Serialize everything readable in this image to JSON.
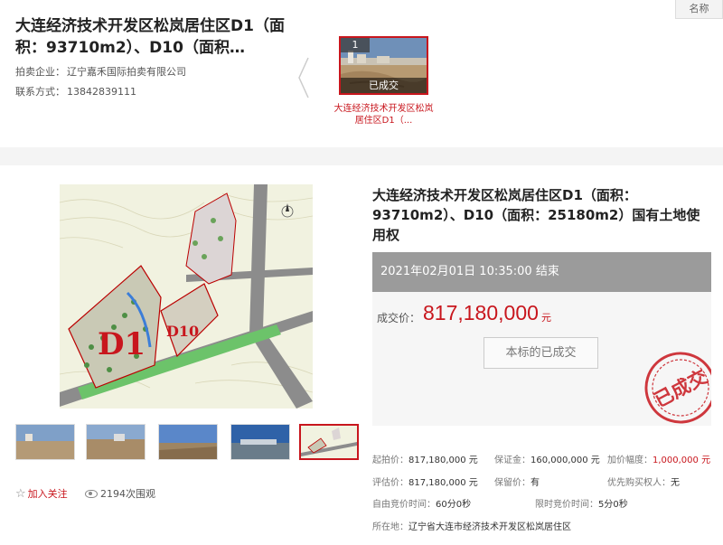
{
  "header": {
    "title": "大连经济技术开发区松岚居住区D1（面积：93710m2）、D10（面积…",
    "company_label": "拍卖企业：",
    "company_name": "辽宁嘉禾国际拍卖有限公司",
    "contact_label": "联系方式：",
    "contact_phone": "13842839111",
    "sort_label": "名称"
  },
  "lot_card": {
    "number": "1",
    "status": "已成交",
    "caption": "大连经济技术开发区松岚居住区D1（..."
  },
  "gallery": {
    "map_labels": [
      "D1",
      "D10"
    ],
    "thumb_count": 5,
    "active_thumb": 4
  },
  "social": {
    "follow_label": "加入关注",
    "views_label": "2194次围观"
  },
  "detail": {
    "title": "大连经济技术开发区松岚居住区D1（面积：93710m2）、D10（面积：25180m2）国有土地使用权",
    "end_time": "2021年02月01日  10:35:00 结束",
    "deal_label": "成交价：",
    "deal_price": "817,180,000",
    "deal_unit": "元",
    "done_button": "本标的已成交",
    "stamp_text": "已成交"
  },
  "info": {
    "start_price_label": "起拍价：",
    "start_price": "817,180,000 元",
    "deposit_label": "保证金：",
    "deposit": "160,000,000 元",
    "increment_label": "加价幅度：",
    "increment": "1,000,000 元",
    "appraisal_label": "评估价：",
    "appraisal": "817,180,000 元",
    "reserve_label": "保留价：",
    "reserve": "有",
    "priority_label": "优先购买权人：",
    "priority": "无",
    "free_time_label": "自由竞价时间：",
    "free_time": "60分0秒",
    "limit_time_label": "限时竞价时间：",
    "limit_time": "5分0秒",
    "location_label": "所在地：",
    "location": "辽宁省大连市经济技术开发区松岚居住区"
  },
  "colors": {
    "accent": "#c8161d",
    "end_bar": "#9b9b9b",
    "price_box": "#f6f6f6"
  }
}
